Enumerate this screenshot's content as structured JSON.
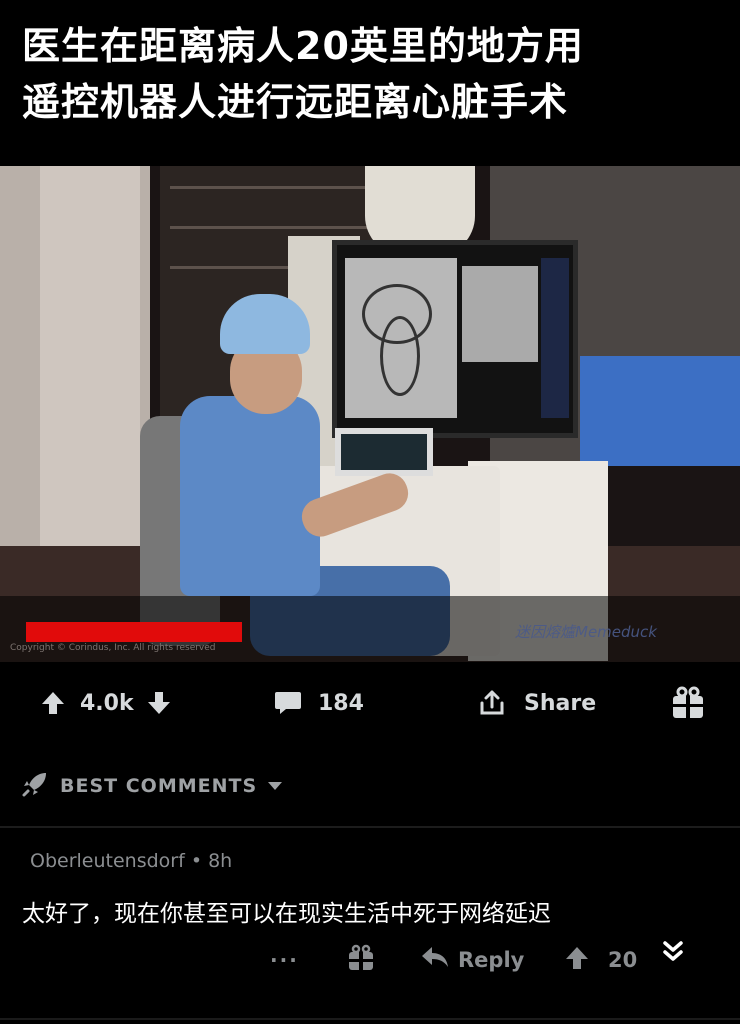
{
  "title": {
    "line1": "医生在距离病人20英里的地方用",
    "line2": "遥控机器人进行远距离心脏手术"
  },
  "media": {
    "copyright": "Copyright © Corindus, Inc. All rights reserved",
    "watermark": "迷因熔爐Memeduck"
  },
  "post_actions": {
    "upvote_count": "4.0k",
    "comment_count": "184",
    "share_label": "Share"
  },
  "sort": {
    "label": "BEST COMMENTS"
  },
  "comment": {
    "author": "Oberleutensdorf",
    "age": "8h",
    "text": "太好了，现在你甚至可以在现实生活中死于网络延迟",
    "more_label": "···",
    "reply_label": "Reply",
    "score": "20"
  },
  "icons": {
    "upvote": "arrow-up-icon",
    "downvote": "arrow-down-icon",
    "comment": "speech-bubble-icon",
    "share": "share-icon",
    "award": "gift-icon",
    "sort": "rocket-icon",
    "reply": "reply-arrow-icon",
    "collapse": "double-chevron-down-icon"
  }
}
